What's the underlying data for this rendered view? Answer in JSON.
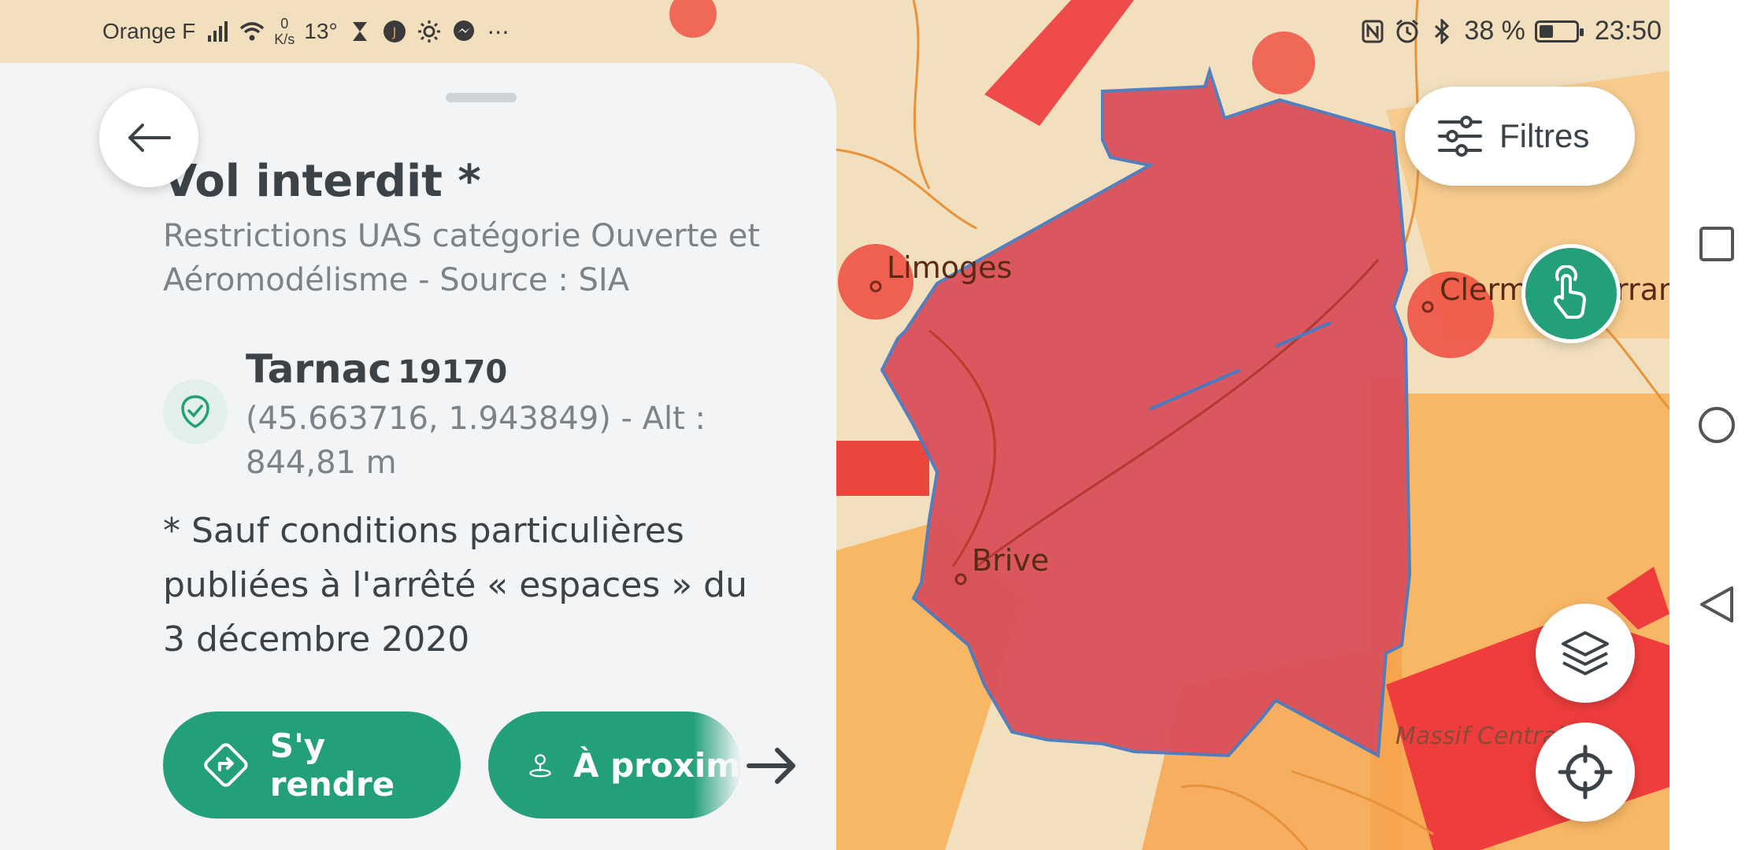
{
  "statusbar": {
    "carrier": "Orange F",
    "net_speed_value": "0",
    "net_speed_unit": "K/s",
    "temperature": "13°",
    "battery_percent": "38 %",
    "battery_level": 0.38,
    "time": "23:50",
    "icons": [
      "signal-icon",
      "wifi-icon",
      "hourglass-icon",
      "app-icon",
      "brightness-icon",
      "messenger-icon",
      "more-icon",
      "nfc-icon",
      "alarm-icon",
      "bluetooth-icon",
      "battery-icon"
    ]
  },
  "panel": {
    "back_icon": "arrow-left-icon",
    "title": "Vol interdit *",
    "subtitle": "Restrictions UAS catégorie Ouverte et Aéromodélisme - Source : SIA",
    "location": {
      "icon": "shield-check-icon",
      "place": "Tarnac",
      "zip": "19170",
      "coords": "(45.663716, 1.943849) - Alt : 844,81 m"
    },
    "footnote": "* Sauf conditions particulières publiées à l'arrêté « espaces » du 3 décembre 2020",
    "buttons": {
      "goto_label": "S'y rendre",
      "goto_icon": "directions-icon",
      "nearby_label": "À proxim",
      "nearby_icon": "pin-icon",
      "more_icon": "arrow-right-icon"
    }
  },
  "map": {
    "labels": {
      "limoges": "Limoges",
      "brive": "Brive",
      "clermont_left": "Clerm",
      "clermont_right": "rran",
      "massif": "Massif Central"
    },
    "zone_color": "#d9505a",
    "filters_label": "Filtres",
    "filters_icon": "sliders-icon",
    "touch_icon": "touch-icon",
    "layers_icon": "layers-icon",
    "locate_icon": "crosshair-icon"
  },
  "navbar": {
    "icons": [
      "square-icon",
      "circle-icon",
      "triangle-back-icon"
    ]
  }
}
